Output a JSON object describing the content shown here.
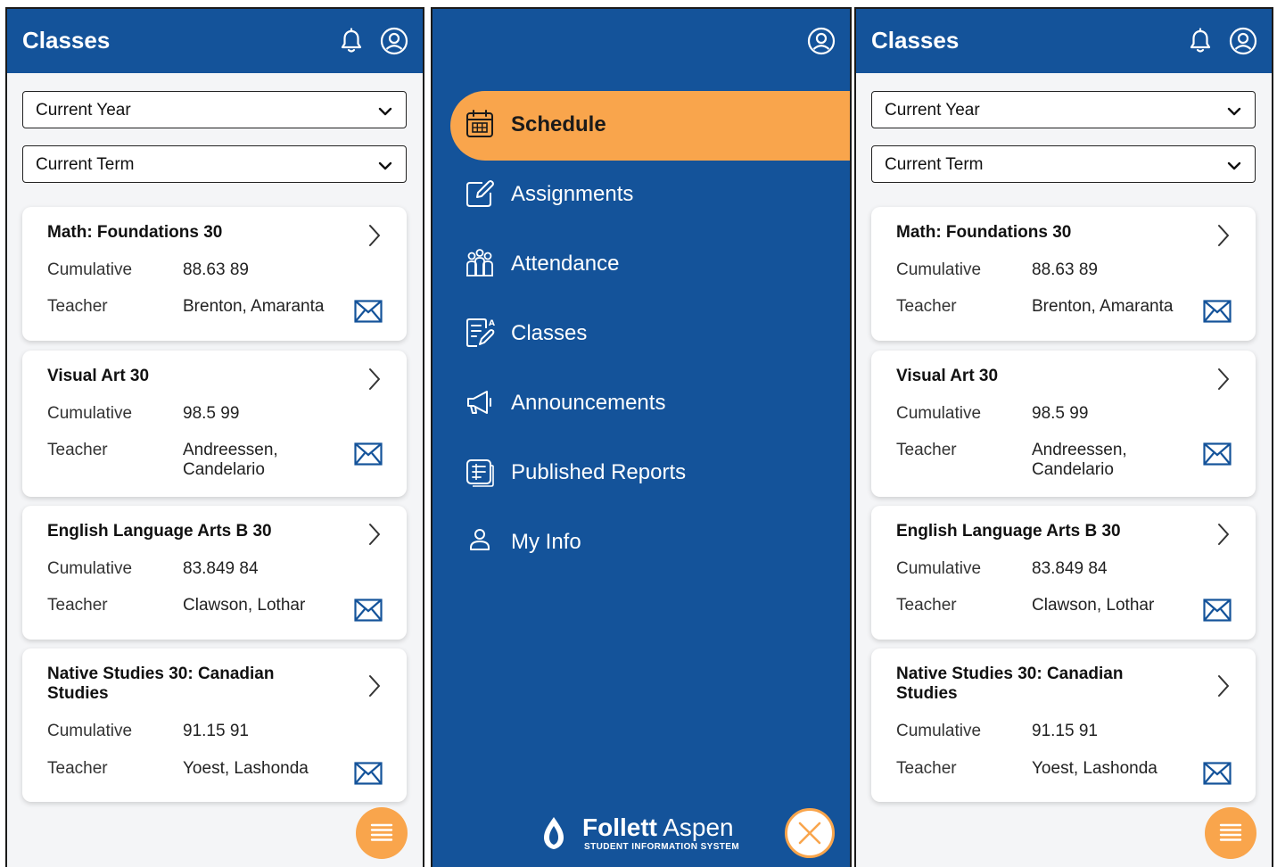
{
  "classes_screen": {
    "title": "Classes",
    "year_select": "Current Year",
    "term_select": "Current Term",
    "cumulative_label": "Cumulative",
    "teacher_label": "Teacher",
    "classes": [
      {
        "name": "Math: Foundations 30",
        "cumulative": "88.63 89",
        "teacher": "Brenton, Amaranta"
      },
      {
        "name": "Visual Art 30",
        "cumulative": "98.5 99",
        "teacher": "Andreessen, Candelario"
      },
      {
        "name": "English Language Arts B 30",
        "cumulative": "83.849 84",
        "teacher": "Clawson, Lothar"
      },
      {
        "name": "Native Studies 30: Canadian Studies",
        "cumulative": "91.15 91",
        "teacher": "Yoest, Lashonda"
      }
    ]
  },
  "menu": {
    "items": [
      {
        "label": "Schedule",
        "icon": "calendar-icon",
        "active": true
      },
      {
        "label": "Assignments",
        "icon": "edit-icon",
        "active": false
      },
      {
        "label": "Attendance",
        "icon": "people-icon",
        "active": false
      },
      {
        "label": "Classes",
        "icon": "class-document-icon",
        "active": false
      },
      {
        "label": "Announcements",
        "icon": "megaphone-icon",
        "active": false
      },
      {
        "label": "Published Reports",
        "icon": "report-icon",
        "active": false
      },
      {
        "label": "My Info",
        "icon": "person-icon",
        "active": false
      }
    ],
    "brand_name_bold": "Follett",
    "brand_name_light": " Aspen",
    "brand_subtitle": "STUDENT INFORMATION SYSTEM"
  },
  "colors": {
    "primary": "#14539a",
    "accent": "#f9a54c",
    "background": "#f4f5f7"
  }
}
